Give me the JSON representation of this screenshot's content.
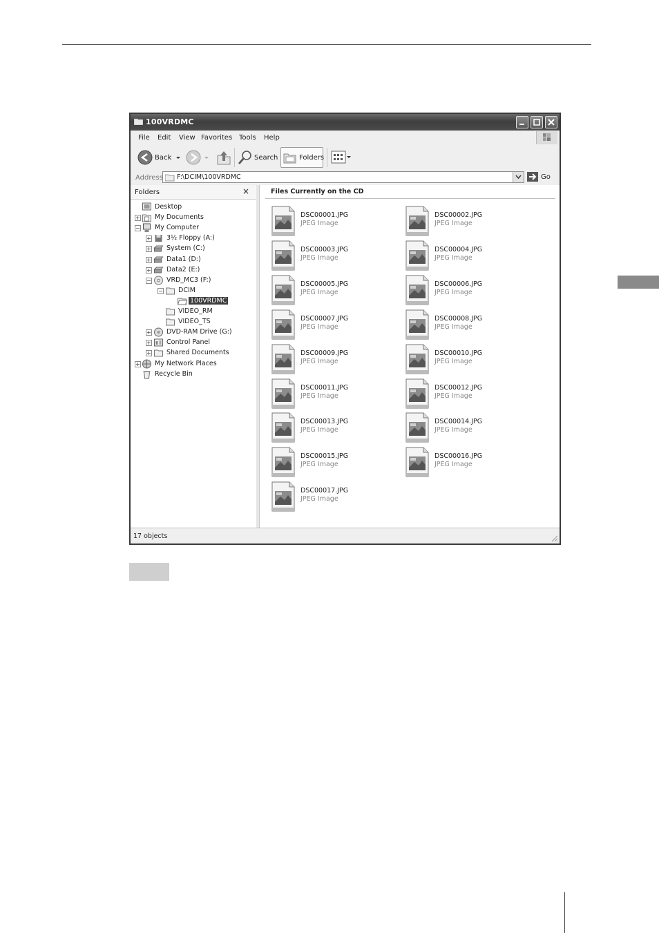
{
  "window": {
    "title": "100VRDMC",
    "menu": [
      "File",
      "Edit",
      "View",
      "Favorites",
      "Tools",
      "Help"
    ],
    "toolbar": {
      "back_label": "Back",
      "search_label": "Search",
      "folders_label": "Folders"
    },
    "address": {
      "label": "Address",
      "value": "F:\\DCIM\\100VRDMC",
      "go_label": "Go"
    },
    "folders_pane": {
      "title": "Folders",
      "close_glyph": "×",
      "tree": [
        {
          "label": "Desktop",
          "icon": "desktop-icon"
        },
        {
          "label": "My Documents",
          "icon": "documents-icon",
          "expander": "+"
        },
        {
          "label": "My Computer",
          "icon": "computer-icon",
          "expander": "−"
        },
        {
          "label": "3½ Floppy (A:)",
          "icon": "floppy-icon",
          "expander": "+"
        },
        {
          "label": "System (C:)",
          "icon": "drive-icon",
          "expander": "+"
        },
        {
          "label": "Data1 (D:)",
          "icon": "drive-icon",
          "expander": "+"
        },
        {
          "label": "Data2 (E:)",
          "icon": "drive-icon",
          "expander": "+"
        },
        {
          "label": "VRD_MC3 (F:)",
          "icon": "cd-icon",
          "expander": "−"
        },
        {
          "label": "DCIM",
          "icon": "folder-icon",
          "expander": "−"
        },
        {
          "label": "100VRDMC",
          "icon": "folder-open-icon",
          "selected": true
        },
        {
          "label": "VIDEO_RM",
          "icon": "folder-icon"
        },
        {
          "label": "VIDEO_TS",
          "icon": "folder-icon"
        },
        {
          "label": "DVD-RAM Drive (G:)",
          "icon": "dvd-drive-icon",
          "expander": "+"
        },
        {
          "label": "Control Panel",
          "icon": "control-panel-icon",
          "expander": "+"
        },
        {
          "label": "Shared Documents",
          "icon": "folder-icon",
          "expander": "+"
        },
        {
          "label": "My Network Places",
          "icon": "network-icon",
          "expander": "+"
        },
        {
          "label": "Recycle Bin",
          "icon": "recycle-bin-icon"
        }
      ]
    },
    "content": {
      "group_title": "Files Currently on the CD",
      "files": [
        {
          "name": "DSC00001.JPG",
          "type": "JPEG Image"
        },
        {
          "name": "DSC00002.JPG",
          "type": "JPEG Image"
        },
        {
          "name": "DSC00003.JPG",
          "type": "JPEG Image"
        },
        {
          "name": "DSC00004.JPG",
          "type": "JPEG Image"
        },
        {
          "name": "DSC00005.JPG",
          "type": "JPEG Image"
        },
        {
          "name": "DSC00006.JPG",
          "type": "JPEG Image"
        },
        {
          "name": "DSC00007.JPG",
          "type": "JPEG Image"
        },
        {
          "name": "DSC00008.JPG",
          "type": "JPEG Image"
        },
        {
          "name": "DSC00009.JPG",
          "type": "JPEG Image"
        },
        {
          "name": "DSC00010.JPG",
          "type": "JPEG Image"
        },
        {
          "name": "DSC00011.JPG",
          "type": "JPEG Image"
        },
        {
          "name": "DSC00012.JPG",
          "type": "JPEG Image"
        },
        {
          "name": "DSC00013.JPG",
          "type": "JPEG Image"
        },
        {
          "name": "DSC00014.JPG",
          "type": "JPEG Image"
        },
        {
          "name": "DSC00015.JPG",
          "type": "JPEG Image"
        },
        {
          "name": "DSC00016.JPG",
          "type": "JPEG Image"
        },
        {
          "name": "DSC00017.JPG",
          "type": "JPEG Image"
        }
      ]
    },
    "status": "17 objects"
  },
  "colors": {
    "titlebar": "#4a4a4a",
    "selection": "#3d3d3d",
    "chrome": "#efefef",
    "side_tab": "#8a8a8a"
  }
}
